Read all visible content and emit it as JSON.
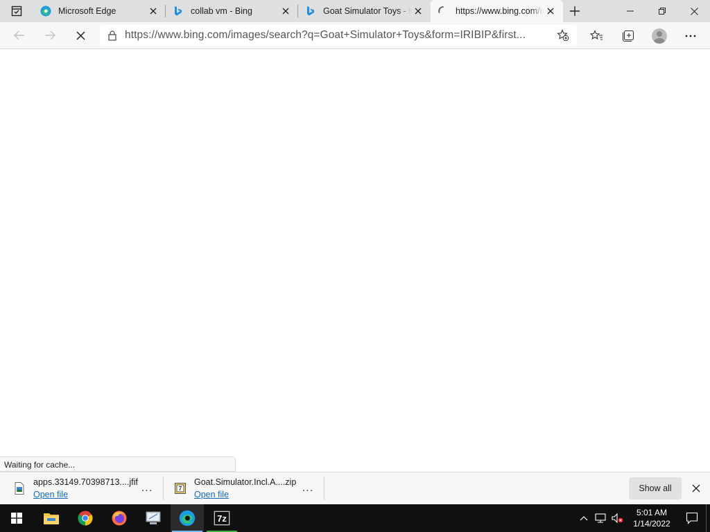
{
  "tabs": [
    {
      "title": "Microsoft Edge",
      "icon": "edge-icon",
      "active": false
    },
    {
      "title": "collab vm - Bing",
      "icon": "bing-icon",
      "active": false
    },
    {
      "title": "Goat Simulator Toys - Bing",
      "icon": "bing-icon",
      "active": false
    },
    {
      "title": "https://www.bing.com/images/search",
      "icon": "loading-spinner-icon",
      "active": true
    }
  ],
  "address_bar": {
    "url": "https://www.bing.com/images/search?q=Goat+Simulator+Toys&form=IRIBIP&first..."
  },
  "status_bubble": {
    "text": "Waiting for cache..."
  },
  "downloads": [
    {
      "filename": "apps.33149.70398713....jfif",
      "action": "Open file",
      "icon": "image-file-icon"
    },
    {
      "filename": "Goat.Simulator.Incl.A....zip",
      "action": "Open file",
      "icon": "zip-file-icon"
    }
  ],
  "download_bar": {
    "show_all_label": "Show all",
    "more_label": "..."
  },
  "taskbar": {
    "apps": [
      "start",
      "file-explorer",
      "chrome",
      "firefox",
      "network-pc",
      "edge",
      "7zip"
    ],
    "time": "5:01 AM",
    "date": "1/14/2022"
  },
  "colors": {
    "tabstrip": "#dedfe1",
    "toolbar": "#f7f7f7",
    "link": "#0f6cbd",
    "taskbar": "#101010"
  }
}
